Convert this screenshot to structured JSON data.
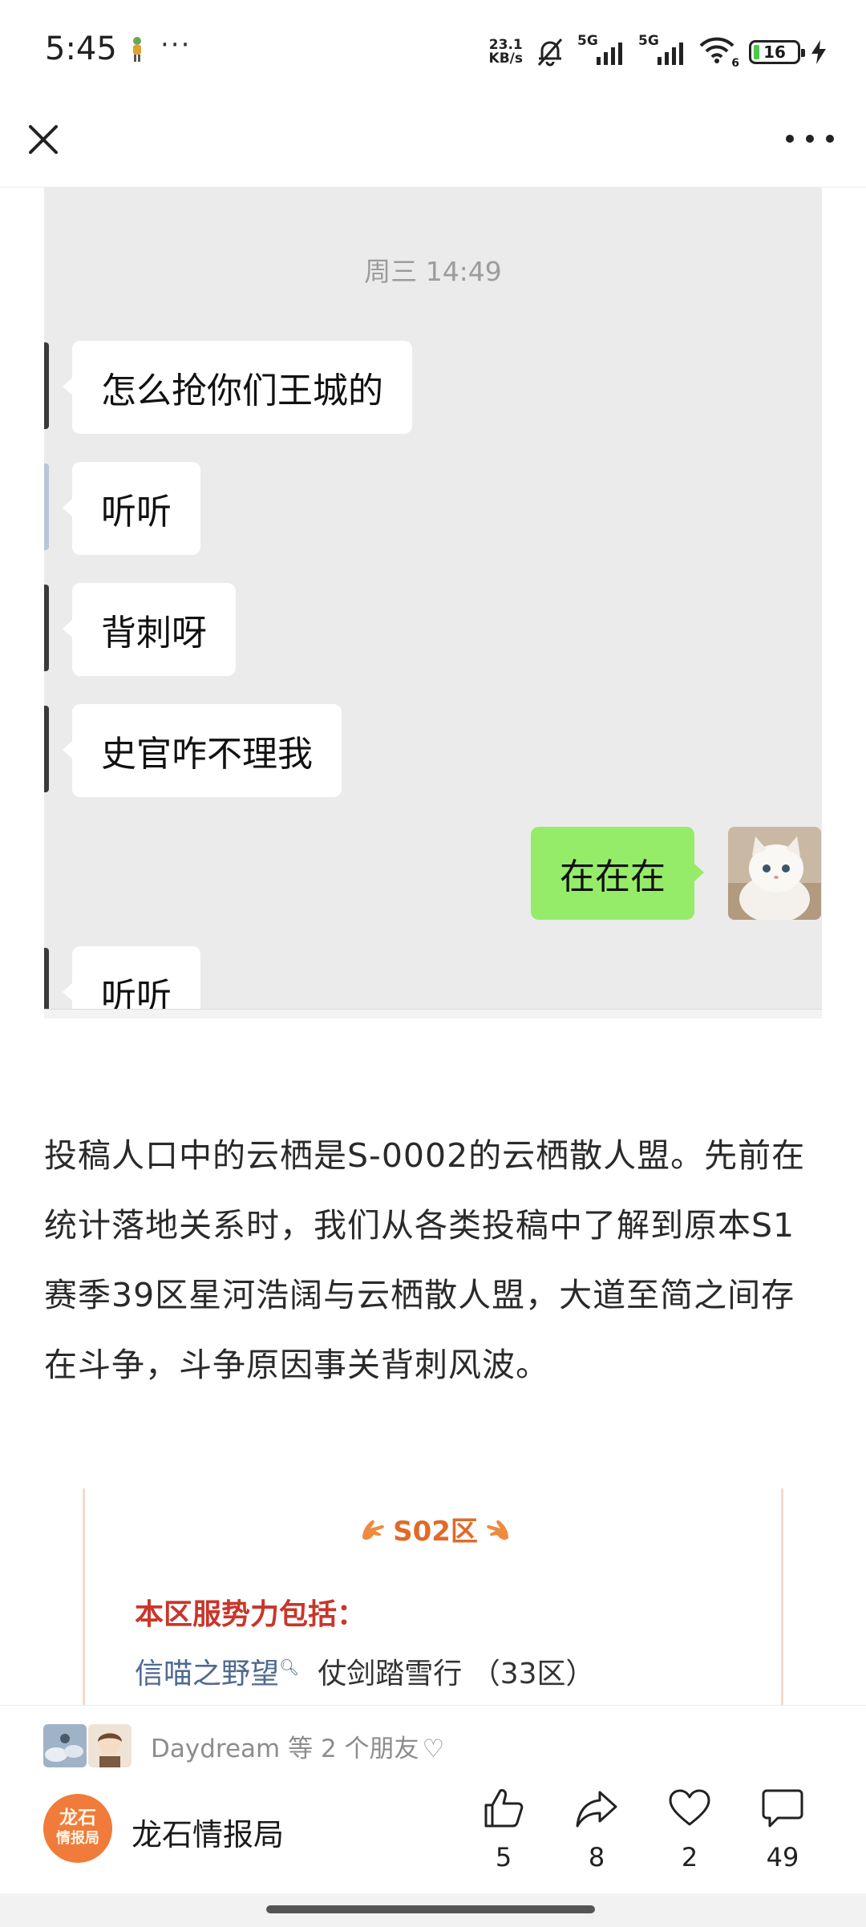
{
  "status_bar": {
    "time": "5:45",
    "more": "···",
    "net_speed_value": "23.1",
    "net_speed_unit": "KB/s",
    "sim1_label": "5G",
    "sim2_label": "5G",
    "wifi_label": "6",
    "battery_level": "16",
    "icons": [
      "app-notification-icon",
      "mute-bell-icon",
      "signal-icon",
      "wifi-icon",
      "battery-icon",
      "charging-icon"
    ]
  },
  "nav": {
    "icons": [
      "close-icon",
      "more-icon"
    ]
  },
  "chat": {
    "timestamp": "周三 14:49",
    "messages": [
      {
        "side": "left",
        "text": "怎么抢你们王城的"
      },
      {
        "side": "left",
        "text": "听听"
      },
      {
        "side": "left",
        "text": "背刺呀"
      },
      {
        "side": "left",
        "text": "史官咋不理我"
      },
      {
        "side": "right",
        "text": "在在在"
      },
      {
        "side": "left",
        "text": "听听"
      }
    ]
  },
  "article": {
    "paragraph": "投稿人口中的云栖是S-0002的云栖散人盟。先前在统计落地关系时，我们从各类投稿中了解到原本S1赛季39区星河浩阔与云栖散人盟，大道至简之间存在斗争，斗争原因事关背刺风波。"
  },
  "region_card": {
    "title": "S02区",
    "subtitle": "本区服势力包括：",
    "link_text": "信喵之野望",
    "link_icon": "search-icon",
    "rest_text": "  仗剑踏雪行 （33区）"
  },
  "bottom": {
    "friends_name": "Daydream",
    "friends_suffix": " 等 2 个朋友",
    "friends_heart": "♡",
    "account_logo_line1": "龙石",
    "account_logo_line2": "情报局",
    "account_name": "龙石情报局",
    "actions": {
      "like": "5",
      "share": "8",
      "favorite": "2",
      "comment": "49"
    }
  },
  "colors": {
    "chat_background": "#ebebeb",
    "my_bubble": "#95ec69",
    "accent_orange": "#e06a2a",
    "subtitle_red": "#c9362b",
    "link_blue": "#4f6a8f"
  }
}
